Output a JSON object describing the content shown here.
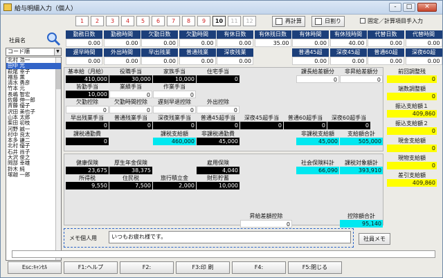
{
  "window": {
    "title": "給与明細入力（個人）",
    "minimize": "-",
    "maximize": "□",
    "close": "✕"
  },
  "toolbar": {
    "page_tabs": [
      "1",
      "2",
      "3",
      "4",
      "5",
      "6",
      "7",
      "8",
      "9",
      "10",
      "11",
      "12"
    ],
    "active_tab": "10",
    "recalc": "再計算",
    "date_split": "日割り",
    "fixed_manual_label": "固定／計算項目手入力"
  },
  "employee": {
    "label": "社員名",
    "sort": "コード順",
    "list": [
      "北村 浩一",
      "田中 光",
      "萩尾 幸子",
      "福島 薫",
      "清水 勇彦",
      "竹本 元",
      "長嶋 智宏",
      "佐藤 伸一郎",
      "斉藤 優子",
      "沢田 美也子",
      "山本 太郎",
      "柴田 初枝",
      "河野 誠一",
      "村中 良太",
      "本多 謙二",
      "北村 優子",
      "石井 尚子",
      "大沢 俊之",
      "岡部 幸雄",
      "鈴木 純",
      "塚越 一郎"
    ],
    "selected": "田中 光"
  },
  "attendance": {
    "row1_labels": [
      "勤務日数",
      "勤務時間",
      "欠勤日数",
      "欠勤時間",
      "有休日数",
      "有休残日数",
      "有休時間",
      "有休残時間",
      "代替日数",
      "代替時間"
    ],
    "row1_values": [
      "0.00",
      "0.00",
      "0.00",
      "0.00",
      "0.00",
      "35.00",
      "0.00",
      "40.00",
      "0.00",
      "0.00"
    ],
    "row2_labels": [
      "遅早時間",
      "外出時間",
      "早出残業",
      "普通残業",
      "深夜残業",
      "",
      "普通45超",
      "深夜45超",
      "普通60超",
      "深夜60超"
    ],
    "row2_values": [
      "0.00",
      "0.00",
      "0.00",
      "0.00",
      "0.00",
      "",
      "0.00",
      "0.00",
      "0.00",
      "0.00"
    ]
  },
  "pay": {
    "r1": [
      [
        "基本給（月給）",
        "410,000"
      ],
      [
        "役職手当",
        "30,000"
      ],
      [
        "家族手当",
        "10,000"
      ],
      [
        "住宅手当",
        "0"
      ],
      [
        "",
        ""
      ],
      [
        "課長給差額分",
        "0"
      ],
      [
        "非昇給差額分",
        "0"
      ]
    ],
    "r2": [
      [
        "皆勤手当",
        "10,000"
      ],
      [
        "業績手当",
        "0"
      ],
      [
        "作業手当",
        "0"
      ]
    ],
    "r3": [
      [
        "欠勤控除",
        "0"
      ],
      [
        "欠勤時間控除",
        "0"
      ],
      [
        "遅刻早退控除",
        "0"
      ],
      [
        "外出控除",
        "0"
      ]
    ],
    "r4": [
      [
        "早出残業手当",
        "0"
      ],
      [
        "普通残業手当",
        "0"
      ],
      [
        "深夜残業手当",
        "0"
      ],
      [
        "普通45超手当",
        "0"
      ],
      [
        "深夜45超手当",
        "0"
      ],
      [
        "普通60超手当",
        "0"
      ],
      [
        "深夜60超手当",
        "0"
      ]
    ],
    "r5": [
      [
        "課税通勤費",
        "0"
      ],
      [
        "",
        ""
      ],
      [
        "課税支給額",
        "460,000"
      ],
      [
        "非課税通勤費",
        "45,000"
      ],
      [
        "",
        ""
      ],
      [
        "非課税支給額",
        "45,000"
      ],
      [
        "支給額合計",
        "505,000"
      ]
    ]
  },
  "deduct": {
    "r1": [
      [
        "健康保険",
        "23,675"
      ],
      [
        "厚生年金保険",
        "38,375"
      ],
      [
        "",
        ""
      ],
      [
        "雇用保険",
        "4,040"
      ],
      [
        "",
        ""
      ],
      [
        "社会保険料計",
        "66,090"
      ],
      [
        "課税対象額計",
        "393,910"
      ]
    ],
    "r2": [
      [
        "所得税",
        "9,550"
      ],
      [
        "住民税",
        "7,500"
      ],
      [
        "旅行積立金",
        "2,000"
      ],
      [
        "財形貯蓄",
        "10,000"
      ]
    ],
    "r3": [
      [
        "昇給差額控除",
        "0"
      ],
      [
        "控除額合計",
        "95,140"
      ]
    ]
  },
  "right": [
    [
      "前回調整残",
      "0"
    ],
    [
      "端数調整額",
      "0"
    ],
    [
      "振込支給額１",
      "409,860"
    ],
    [
      "振込支給額２",
      "0"
    ],
    [
      "現金支給額",
      "0"
    ],
    [
      "現物支給額",
      "0"
    ],
    [
      "差引支給額",
      "409,860"
    ]
  ],
  "memo": {
    "label": "メモ個人用",
    "value": "いつもお疲れ様です。",
    "employee_memo": "社員メモ"
  },
  "fkeys": [
    "Esc:ｷｬﾝｾﾙ",
    "F1:ヘルプ",
    "F2:",
    "F3:印 刷",
    "F4:",
    "F5:閉じる"
  ]
}
